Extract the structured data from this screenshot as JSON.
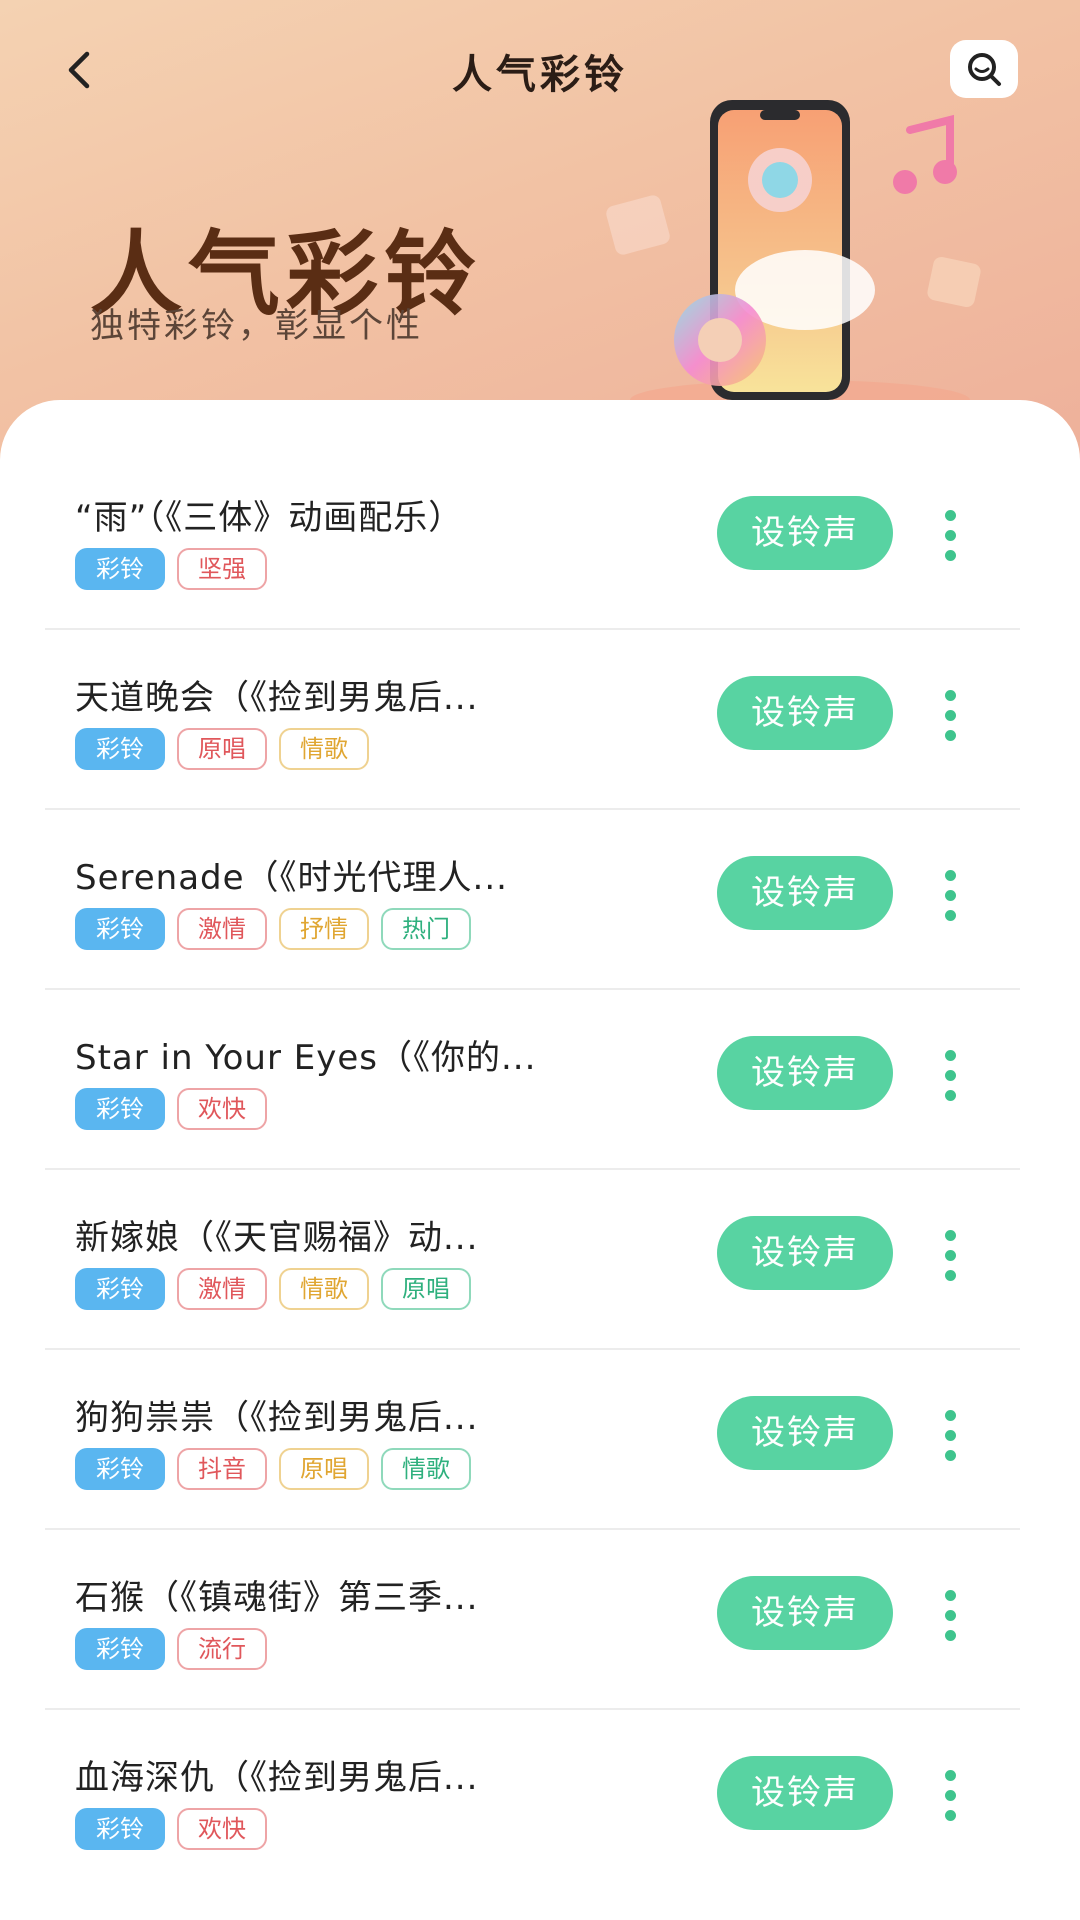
{
  "nav": {
    "title": "人气彩铃",
    "back_icon": "chevron-left-icon",
    "search_icon": "search-icon"
  },
  "hero": {
    "title": "人气彩铃",
    "subtitle": "独特彩铃，彰显个性"
  },
  "colors": {
    "accent": "#58d3a2",
    "tag_primary": "#5ab6f0",
    "tag_red": "#e0575b",
    "tag_yellow": "#e0a632",
    "tag_green": "#2fb07e"
  },
  "list": {
    "items": [
      {
        "title": "“雨”（《三体》动画配乐）",
        "tags": [
          {
            "label": "彩铃",
            "style": "primary"
          },
          {
            "label": "坚强",
            "style": "red"
          }
        ],
        "button": "设铃声"
      },
      {
        "title": "天道晚会（《捡到男鬼后...",
        "tags": [
          {
            "label": "彩铃",
            "style": "primary"
          },
          {
            "label": "原唱",
            "style": "red"
          },
          {
            "label": "情歌",
            "style": "yellow"
          }
        ],
        "button": "设铃声"
      },
      {
        "title": "Serenade（《时光代理人...",
        "tags": [
          {
            "label": "彩铃",
            "style": "primary"
          },
          {
            "label": "激情",
            "style": "red"
          },
          {
            "label": "抒情",
            "style": "yellow"
          },
          {
            "label": "热门",
            "style": "green"
          }
        ],
        "button": "设铃声"
      },
      {
        "title": "Star in Your Eyes（《你的...",
        "tags": [
          {
            "label": "彩铃",
            "style": "primary"
          },
          {
            "label": "欢快",
            "style": "red"
          }
        ],
        "button": "设铃声"
      },
      {
        "title": "新嫁娘（《天官赐福》动...",
        "tags": [
          {
            "label": "彩铃",
            "style": "primary"
          },
          {
            "label": "激情",
            "style": "red"
          },
          {
            "label": "情歌",
            "style": "yellow"
          },
          {
            "label": "原唱",
            "style": "green"
          }
        ],
        "button": "设铃声"
      },
      {
        "title": "狗狗祟祟（《捡到男鬼后...",
        "tags": [
          {
            "label": "彩铃",
            "style": "primary"
          },
          {
            "label": "抖音",
            "style": "red"
          },
          {
            "label": "原唱",
            "style": "yellow"
          },
          {
            "label": "情歌",
            "style": "green"
          }
        ],
        "button": "设铃声"
      },
      {
        "title": "石猴（《镇魂街》第三季...",
        "tags": [
          {
            "label": "彩铃",
            "style": "primary"
          },
          {
            "label": "流行",
            "style": "red"
          }
        ],
        "button": "设铃声"
      },
      {
        "title": "血海深仇（《捡到男鬼后...",
        "tags": [
          {
            "label": "彩铃",
            "style": "primary"
          },
          {
            "label": "欢快",
            "style": "red"
          }
        ],
        "button": "设铃声"
      }
    ]
  }
}
